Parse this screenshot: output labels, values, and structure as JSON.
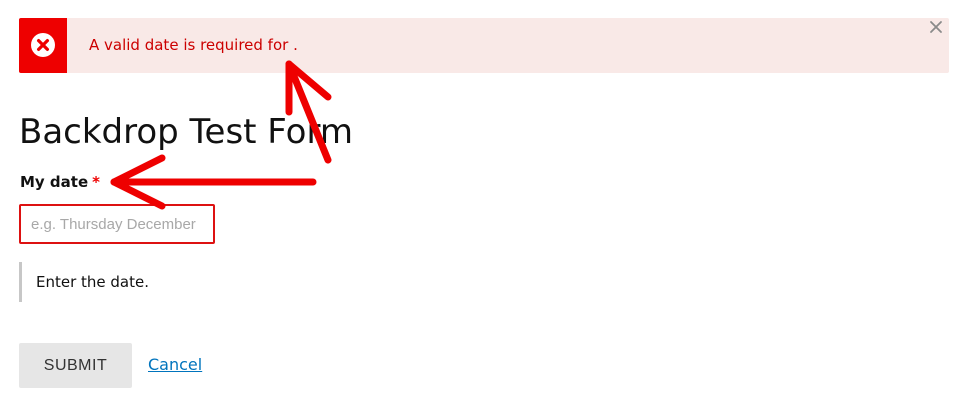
{
  "messages": {
    "error_text": "A valid date is required for .",
    "icon": "error-circle-x-icon",
    "close_icon": "close-icon"
  },
  "page": {
    "title": "Backdrop Test Form"
  },
  "form": {
    "date_field": {
      "label": "My date",
      "required_marker": "*",
      "value": "",
      "placeholder": "e.g. Thursday December",
      "description": "Enter the date."
    },
    "submit_label": "SUBMIT",
    "cancel_label": "Cancel"
  },
  "annotations": {
    "arrow_color": "#ee0000",
    "arrows": [
      "arrow-to-error-message",
      "arrow-to-field-label"
    ]
  },
  "colors": {
    "error_red": "#ee0000",
    "error_bg": "#f9e9e7",
    "link_blue": "#0074bd"
  }
}
